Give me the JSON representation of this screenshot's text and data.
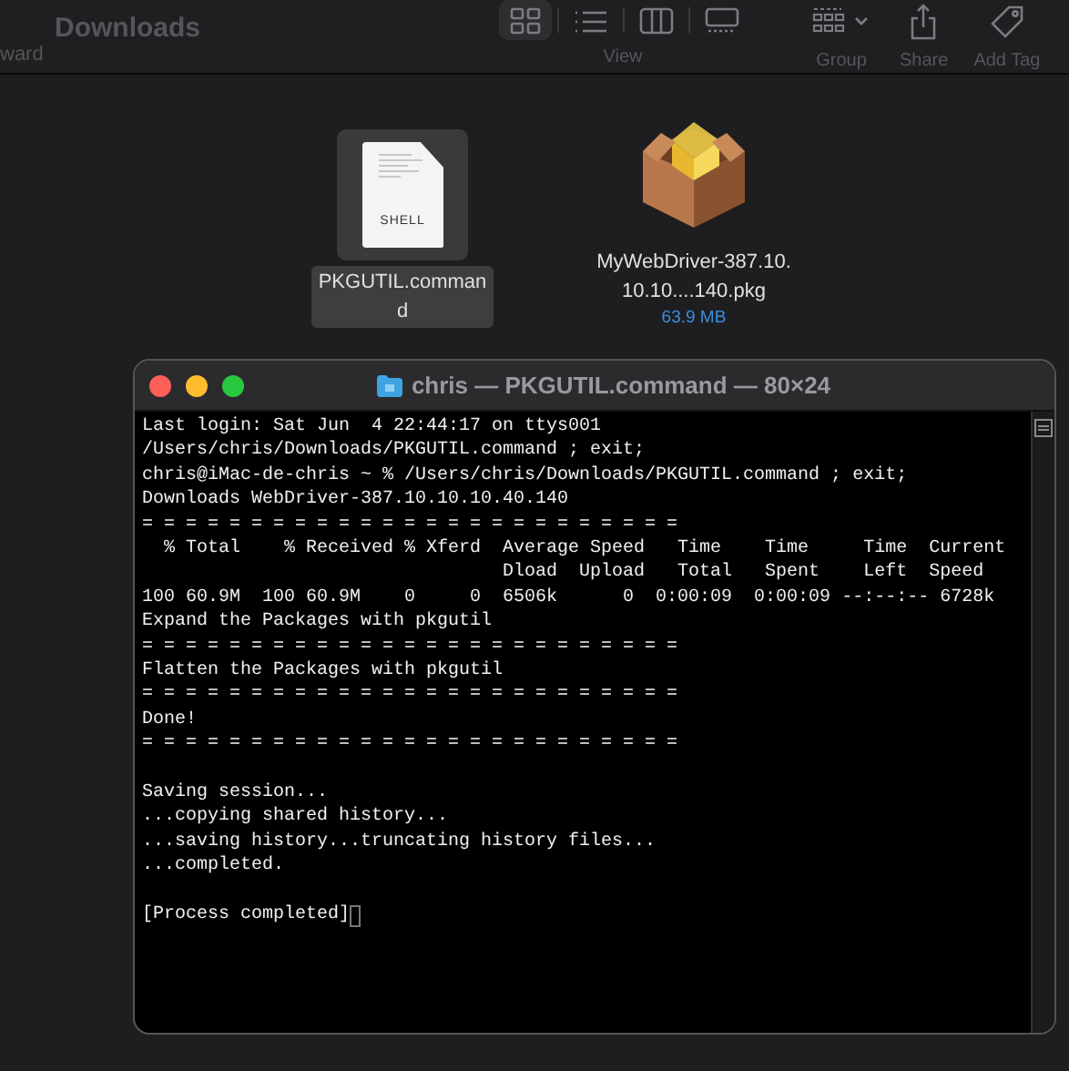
{
  "toolbar": {
    "back_label": "ward",
    "title": "Downloads",
    "view_label": "View",
    "view_modes": [
      {
        "kind": "icons",
        "selected": true
      },
      {
        "kind": "list",
        "selected": false
      },
      {
        "kind": "columns",
        "selected": false
      },
      {
        "kind": "gallery",
        "selected": false
      }
    ],
    "actions": [
      {
        "kind": "group",
        "label": "Group"
      },
      {
        "kind": "share",
        "label": "Share"
      },
      {
        "kind": "tag",
        "label": "Add Tag"
      }
    ]
  },
  "files": [
    {
      "kind": "shell",
      "badge": "SHELL",
      "name": "PKGUTIL.command",
      "selected": true
    },
    {
      "kind": "package",
      "name": "MyWebDriver-387.10.10.10....140.pkg",
      "size": "63.9 MB",
      "selected": false
    }
  ],
  "terminal": {
    "title": "chris — PKGUTIL.command — 80×24",
    "blocks": [
      [
        "Last login: Sat Jun  4 22:44:17 on ttys001",
        "/Users/chris/Downloads/PKGUTIL.command ; exit;",
        "chris@iMac-de-chris ~ % /Users/chris/Downloads/PKGUTIL.command ; exit;",
        "Downloads WebDriver-387.10.10.10.40.140",
        "= = = = = = = = = = = = = = = = = = = = = = = = =",
        "  % Total    % Received % Xferd  Average Speed   Time    Time     Time  Current",
        "                                 Dload  Upload   Total   Spent    Left  Speed",
        "100 60.9M  100 60.9M    0     0  6506k      0  0:00:09  0:00:09 --:--:-- 6728k",
        "Expand the Packages with pkgutil",
        "= = = = = = = = = = = = = = = = = = = = = = = = =",
        "Flatten the Packages with pkgutil",
        "= = = = = = = = = = = = = = = = = = = = = = = = =",
        "Done!",
        "= = = = = = = = = = = = = = = = = = = = = = = = ="
      ],
      [
        "Saving session...",
        "...copying shared history...",
        "...saving history...truncating history files...",
        "...completed."
      ],
      [
        "[Process completed]"
      ]
    ],
    "cursor": true
  }
}
